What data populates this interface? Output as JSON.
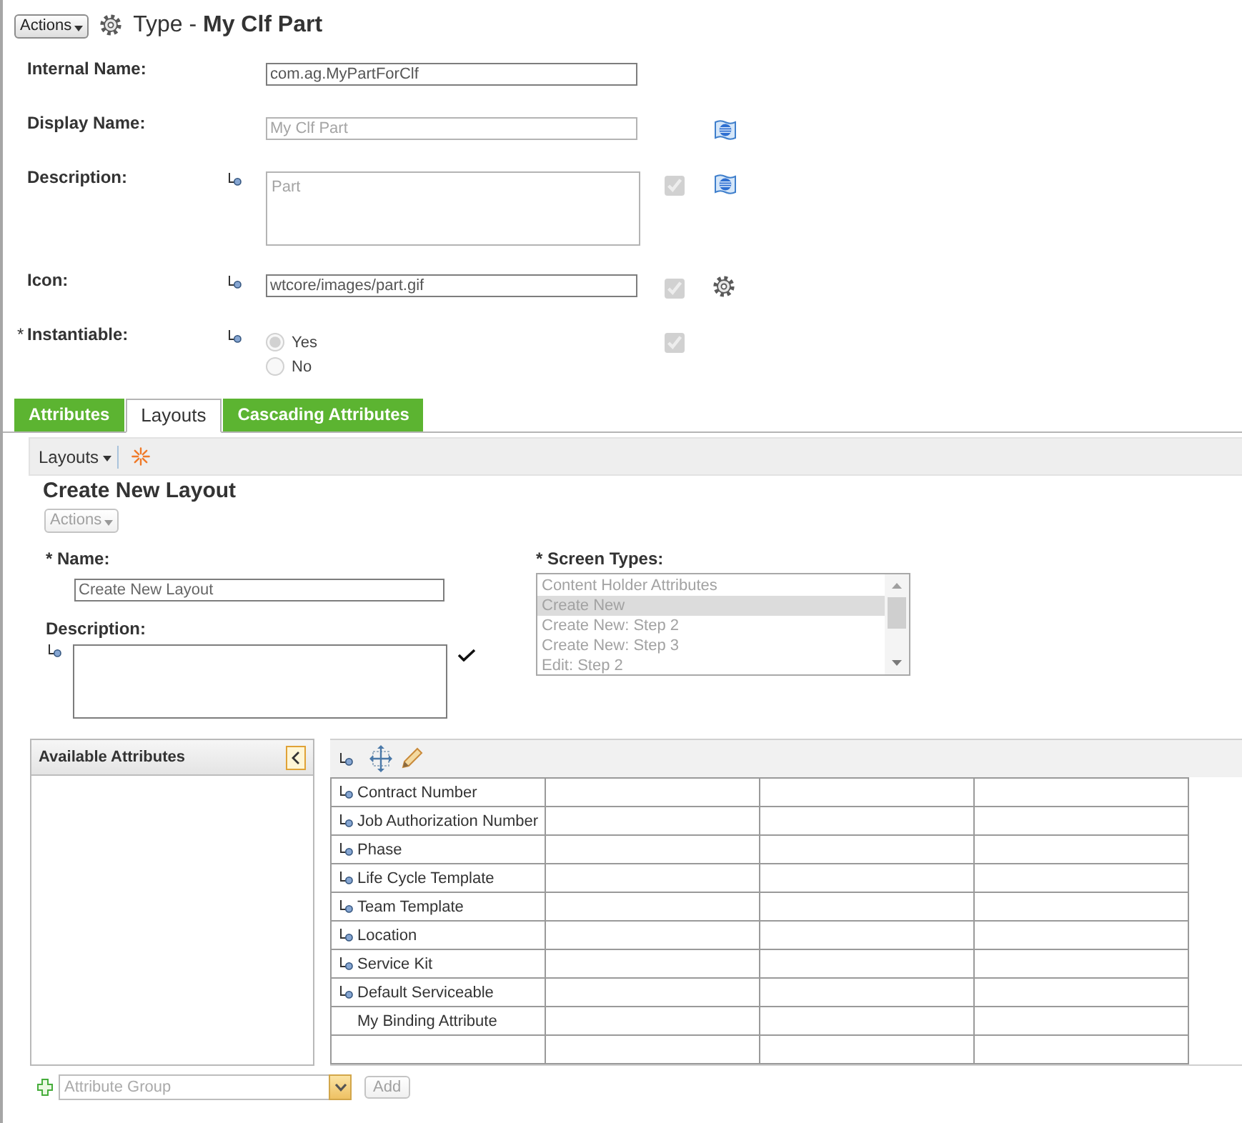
{
  "header": {
    "actions_button": "Actions",
    "title": "Type - **My Clf Part**"
  },
  "type_fields": [
    {
      "kind": "text",
      "label": "Internal Name:",
      "value": "com.ag.MyPartForClf",
      "disabled": false,
      "inherited": false
    },
    {
      "kind": "text",
      "label": "Display Name:",
      "value": "My Clf Part",
      "disabled": true,
      "inherited": false,
      "trailing_button": {
        "kind": "localize"
      }
    },
    {
      "kind": "textarea",
      "label": "Description:",
      "value": "Part",
      "disabled": true,
      "inherited": true,
      "checkbox": {
        "checked": true,
        "disabled": true
      },
      "trailing_button": {
        "kind": "localize"
      }
    },
    {
      "kind": "text",
      "label": "Icon:",
      "value": "wtcore/images/part.gif",
      "disabled": false,
      "inherited": true,
      "checkbox": {
        "checked": true,
        "disabled": true
      },
      "trailing_button": {
        "kind": "browse"
      }
    },
    {
      "kind": "radio",
      "required_mark": "*",
      "label": "Instantiable:",
      "disabled": true,
      "inherited": true,
      "checkbox": {
        "checked": true,
        "disabled": true
      },
      "options": [
        {
          "label": "Yes",
          "selected": true
        },
        {
          "label": "No",
          "selected": false
        }
      ]
    }
  ],
  "tabs": [
    {
      "label": "Attributes",
      "selected": false
    },
    {
      "label": "Layouts",
      "selected": true
    },
    {
      "label": "Cascading Attributes",
      "selected": false
    }
  ],
  "layouts_toolbar": {
    "menu": "Layouts"
  },
  "layout_form": {
    "title": "Create New Layout",
    "actions_button": {
      "label": "Actions",
      "disabled": true
    },
    "name": {
      "label": "* Name:",
      "value": "Create New Layout"
    },
    "description": {
      "label": "Description:",
      "inherited": true
    },
    "screen_types": {
      "label": "* Screen Types:",
      "disabled": true,
      "options": [
        {
          "label": "Content Holder Attributes",
          "selected": false
        },
        {
          "label": "Create New",
          "selected": true
        },
        {
          "label": "Create New: Step 2",
          "selected": false
        },
        {
          "label": "Create New: Step 3",
          "selected": false
        },
        {
          "label": "Edit: Step 2",
          "selected": false
        }
      ]
    }
  },
  "available_attributes": {
    "title": "Available Attributes"
  },
  "layout_grid": {
    "rows": [
      {
        "label": "Contract Number",
        "inherited": true
      },
      {
        "label": "Job Authorization Number",
        "inherited": true
      },
      {
        "label": "Phase",
        "inherited": true
      },
      {
        "label": "Life Cycle Template",
        "inherited": true
      },
      {
        "label": "Team Template",
        "inherited": true
      },
      {
        "label": "Location",
        "inherited": true
      },
      {
        "label": "Service Kit",
        "inherited": true
      },
      {
        "label": "Default Serviceable",
        "inherited": true
      },
      {
        "label": "My Binding Attribute",
        "inherited": false
      },
      {
        "inherited": false
      }
    ]
  },
  "attribute_group": {
    "placeholder": "Attribute Group",
    "add_button": {
      "label": "Add",
      "disabled": true
    }
  }
}
